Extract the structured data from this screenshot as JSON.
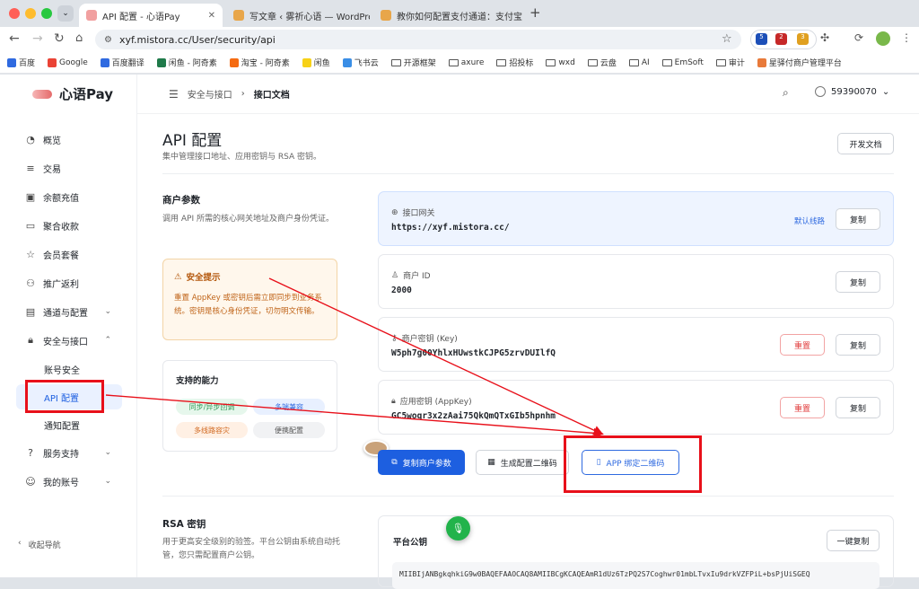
{
  "browser": {
    "tabs": [
      {
        "title": "API 配置 - 心语Pay",
        "active": true
      },
      {
        "title": "写文章 ‹ 雾祈心语 — WordPress",
        "active": false
      },
      {
        "title": "教你如何配置支付通道：支付宝",
        "active": false
      }
    ],
    "new_tab": "+",
    "url": "xyf.mistora.cc/User/security/api",
    "extension_badges": [
      "5",
      "2",
      "3"
    ],
    "bookmarks": [
      "百度",
      "Google",
      "百度翻译",
      "闲鱼 - 阿奇素",
      "淘宝 - 阿奇素",
      "闲鱼",
      "飞书云",
      "开源框架",
      "axure",
      "招投标",
      "wxd",
      "云盘",
      "AI",
      "EmSoft",
      "审计",
      "星驿付商户管理平台"
    ]
  },
  "sidebar": {
    "brand": "心语Pay",
    "items": [
      {
        "label": "概览",
        "icon": "dashboard-icon"
      },
      {
        "label": "交易",
        "icon": "list-icon"
      },
      {
        "label": "余额充值",
        "icon": "wallet-icon"
      },
      {
        "label": "聚合收款",
        "icon": "card-icon"
      },
      {
        "label": "会员套餐",
        "icon": "star-icon"
      },
      {
        "label": "推广返利",
        "icon": "users-icon"
      },
      {
        "label": "通道与配置",
        "icon": "server-icon",
        "expandable": true
      },
      {
        "label": "安全与接口",
        "icon": "lock-icon",
        "expandable": true,
        "expanded": true
      }
    ],
    "sub_items": [
      "账号安全",
      "API 配置",
      "通知配置"
    ],
    "bottom_items": [
      {
        "label": "服务支持",
        "icon": "help-icon"
      },
      {
        "label": "我的账号",
        "icon": "user-icon"
      }
    ],
    "collapse_label": "收起导航"
  },
  "header": {
    "breadcrumb": [
      "安全与接口",
      "接口文档"
    ],
    "username": "59390070"
  },
  "page": {
    "title": "API 配置",
    "subtitle": "集中管理接口地址、应用密钥与 RSA 密钥。",
    "docs_button": "开发文档"
  },
  "merchant": {
    "title": "商户参数",
    "desc": "调用 API 所需的核心网关地址及商户身份凭证。",
    "warning_title": "安全提示",
    "warning_text": "重置 AppKey 或密钥后需立即同步到业务系统。密钥是核心身份凭证，切勿明文传输。",
    "caps_title": "支持的能力",
    "caps": [
      "同步/异步回调",
      "多端兼容",
      "多线路容灾",
      "便携配置"
    ],
    "gateway_label": "接口网关",
    "gateway_value": "https://xyf.mistora.cc/",
    "gateway_link": "默认线路",
    "id_label": "商户 ID",
    "id_value": "2000",
    "key_label": "商户密钥 (Key)",
    "key_value": "W5ph7g00YhlxHUwstkCJPG5zrvDUIlfQ",
    "appkey_label": "应用密钥 (AppKey)",
    "appkey_value": "GC5woqr3x2zAai75QkQmQTxGIb5hpnhm",
    "copy_label": "复制",
    "reset_label": "重置",
    "copy_params": "复制商户参数",
    "gen_qr": "生成配置二维码",
    "app_bind": "APP 绑定二维码"
  },
  "rsa": {
    "title": "RSA 密钥",
    "desc": "用于更高安全级别的验签。平台公钥由系统自动托管，您只需配置商户公钥。",
    "platform_key_label": "平台公钥",
    "copy_all": "一键复制",
    "key_snippet": "MIIBIjANBgkqhkiG9w0BAQEFAAOCAQ8AMIIBCgKCAQEAmR1dUz6TzPQ2S7Coghwr01mbLTvxIu9drkVZFPiL+bsPjUiSGEQ"
  }
}
